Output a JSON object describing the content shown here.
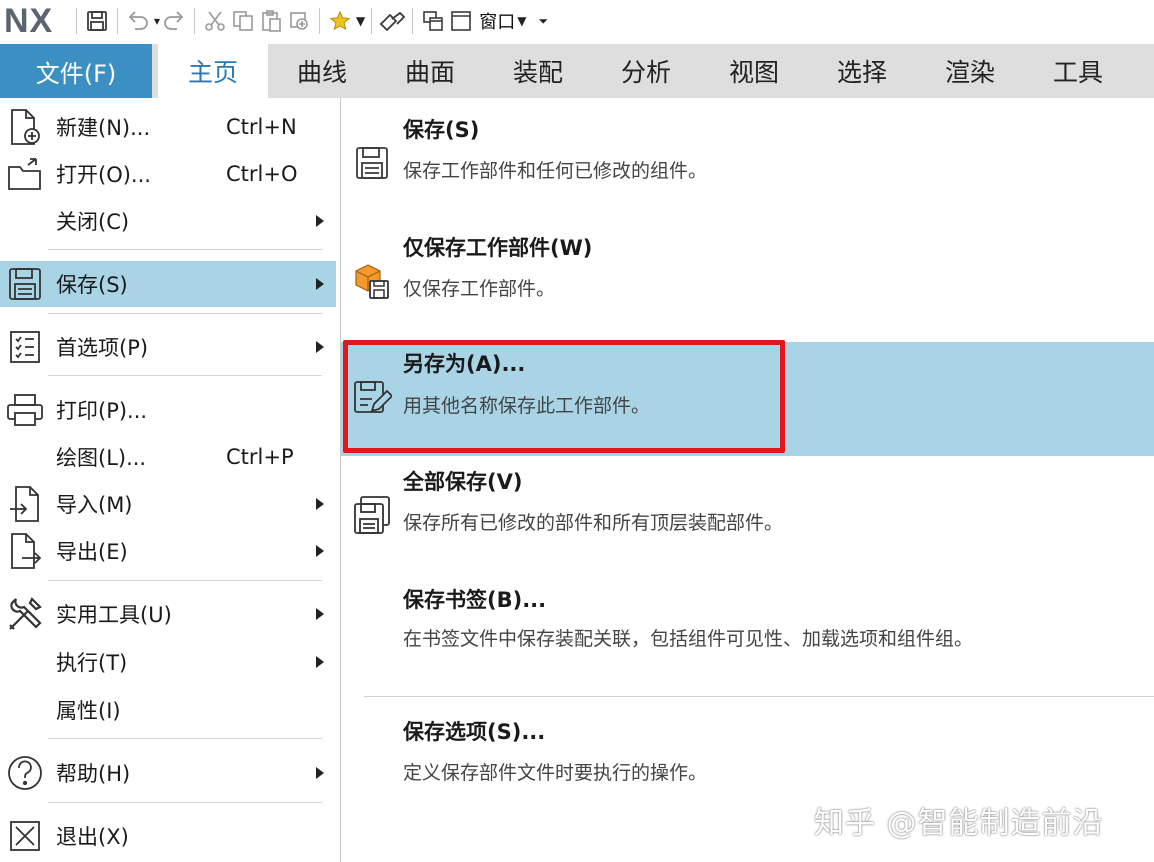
{
  "qat": {
    "logo": "NX",
    "window_label": "窗口",
    "icons": [
      "save-icon",
      "undo-icon",
      "redo-icon",
      "cut-icon",
      "copy-icon",
      "paste-icon",
      "repeat-command-icon",
      "favorite-star-icon",
      "touch-mode-icon",
      "switch-window-icon",
      "window-icon",
      "customize-toolbar-icon"
    ]
  },
  "tabs": {
    "file": "文件(F)",
    "items": [
      "主页",
      "曲线",
      "曲面",
      "装配",
      "分析",
      "视图",
      "选择",
      "渲染",
      "工具"
    ]
  },
  "file_menu": {
    "items": [
      {
        "label": "新建(N)...",
        "shortcut": "Ctrl+N",
        "icon": "new-file-icon"
      },
      {
        "label": "打开(O)...",
        "shortcut": "Ctrl+O",
        "icon": "open-folder-icon"
      },
      {
        "label": "关闭(C)",
        "shortcut": "",
        "icon": "",
        "submenu": true
      },
      {
        "label": "保存(S)",
        "shortcut": "",
        "icon": "save-icon",
        "submenu": true,
        "selected": true
      },
      {
        "label": "首选项(P)",
        "shortcut": "",
        "icon": "preferences-icon",
        "submenu": true
      },
      {
        "label": "打印(P)...",
        "shortcut": "",
        "icon": "printer-icon"
      },
      {
        "label": "绘图(L)...",
        "shortcut": "Ctrl+P",
        "icon": ""
      },
      {
        "label": "导入(M)",
        "shortcut": "",
        "icon": "import-icon",
        "submenu": true
      },
      {
        "label": "导出(E)",
        "shortcut": "",
        "icon": "export-icon",
        "submenu": true
      },
      {
        "label": "实用工具(U)",
        "shortcut": "",
        "icon": "tools-icon",
        "submenu": true
      },
      {
        "label": "执行(T)",
        "shortcut": "",
        "icon": "",
        "submenu": true
      },
      {
        "label": "属性(I)",
        "shortcut": "",
        "icon": ""
      },
      {
        "label": "帮助(H)",
        "shortcut": "",
        "icon": "help-icon",
        "submenu": true
      },
      {
        "label": "退出(X)",
        "shortcut": "",
        "icon": "exit-icon"
      }
    ]
  },
  "save_submenu": {
    "items": [
      {
        "title": "保存(S)",
        "desc": "保存工作部件和任何已修改的组件。",
        "icon": "save-icon"
      },
      {
        "title": "仅保存工作部件(W)",
        "desc": "仅保存工作部件。",
        "icon": "save-work-part-icon"
      },
      {
        "title": "另存为(A)...",
        "desc": "用其他名称保存此工作部件。",
        "icon": "save-as-icon",
        "selected": true,
        "highlighted": true
      },
      {
        "title": "全部保存(V)",
        "desc": "保存所有已修改的部件和所有顶层装配部件。",
        "icon": "save-all-icon"
      },
      {
        "title": "保存书签(B)...",
        "desc": "在书签文件中保存装配关联，包括组件可见性、加载选项和组件组。",
        "icon": ""
      },
      {
        "title": "保存选项(S)...",
        "desc": "定义保存部件文件时要执行的操作。",
        "icon": ""
      }
    ]
  },
  "colors": {
    "file_tab": "#3b8fc2",
    "active_tab_text": "#2a78b5",
    "selection": "#a8d4e6",
    "highlight_box": "#e3151d"
  },
  "watermark": "知乎 @智能制造前沿"
}
